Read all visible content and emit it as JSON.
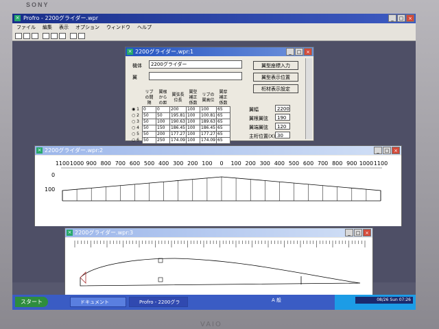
{
  "bezel": {
    "brand": "SONY",
    "bottom_brand": "VAIO"
  },
  "app": {
    "title": "Profro - 2200グライダー.wpr",
    "menu": [
      "ファイル",
      "編集",
      "表示",
      "オプション",
      "ウィンドウ",
      "ヘルプ"
    ]
  },
  "win1": {
    "title": "2200グライダー.wpr:1",
    "name_label": "機体",
    "name_value": "2200グライダー",
    "wing_label": "翼",
    "buttons": [
      "翼型座標入力",
      "翼型表示位置",
      "桁材表示設定"
    ],
    "columns": [
      "リブの間隔",
      "翼根からの距",
      "翼弦長位長",
      "翼型補正係数",
      "リブの翼高位",
      "翼厚補正係数"
    ],
    "rows": [
      [
        "0",
        "0",
        "200",
        "100",
        "100",
        "65"
      ],
      [
        "50",
        "50",
        "195.81",
        "100",
        "100.81",
        "65"
      ],
      [
        "50",
        "100",
        "190.63",
        "100",
        "189.63",
        "65"
      ],
      [
        "50",
        "150",
        "186.45",
        "100",
        "186.45",
        "65"
      ],
      [
        "50",
        "200",
        "177.27",
        "100",
        "177.27",
        "65"
      ],
      [
        "50",
        "250",
        "174.09",
        "100",
        "174.09",
        "65"
      ]
    ],
    "params": [
      {
        "label": "翼幅",
        "value": "2200"
      },
      {
        "label": "翼根翼弦",
        "value": "190"
      },
      {
        "label": "翼端翼弦",
        "value": "120"
      },
      {
        "label": "主桁位置(X)",
        "value": "30"
      }
    ]
  },
  "win2": {
    "title": "2200グライダー.wpr:2",
    "ruler": [
      "1100",
      "1000",
      "900",
      "800",
      "700",
      "600",
      "500",
      "400",
      "300",
      "200",
      "100",
      "0",
      "100",
      "200",
      "300",
      "400",
      "500",
      "600",
      "700",
      "800",
      "900",
      "1000",
      "1100"
    ],
    "y_ticks": [
      "0",
      "100"
    ]
  },
  "win3": {
    "title": "2200グライダー.wpr:3"
  },
  "taskbar": {
    "start": "スタート",
    "tasks": [
      "ドキュメント",
      "Profro - 2200グラ"
    ],
    "ime": "A 般",
    "clock": "08/26 Sun 07:26"
  }
}
